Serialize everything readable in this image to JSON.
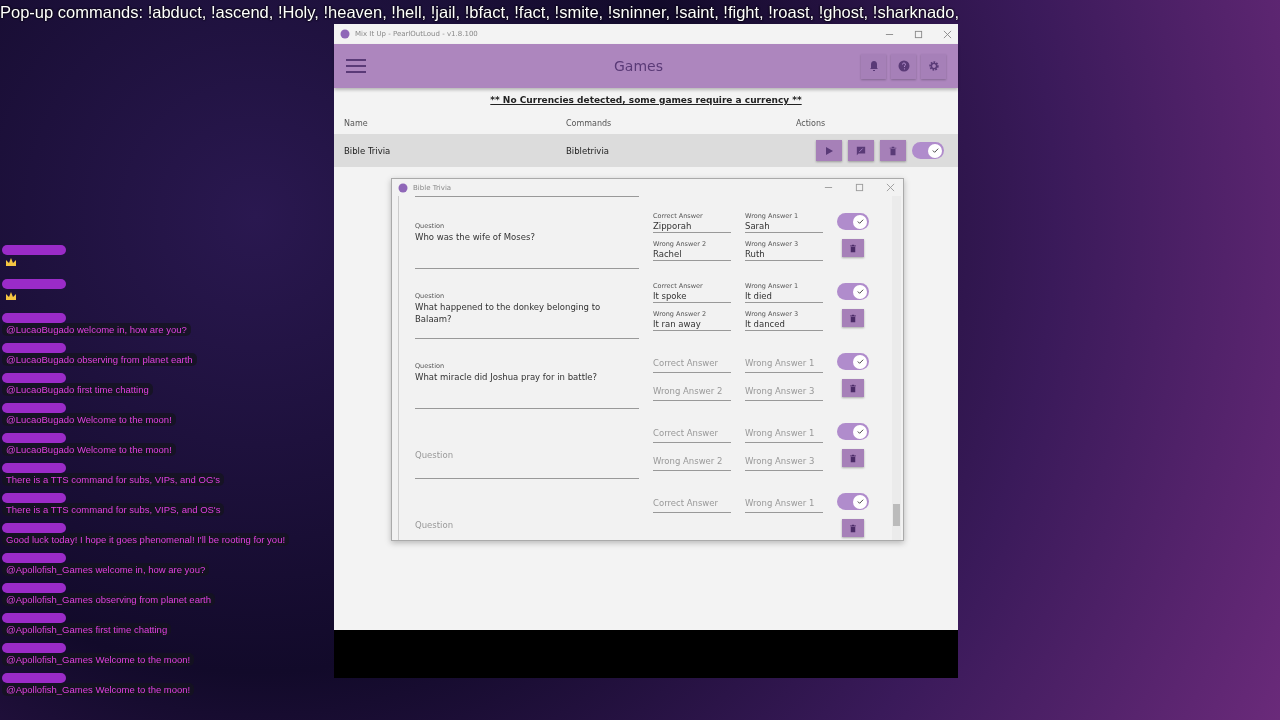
{
  "overlay_caption": "Pop-up commands: !abduct, !ascend, !Holy, !heaven, !hell,  !jail, !bfact, !fact, !smite, !sninner, !saint, !fight, !roast, !ghost, !sharknado,",
  "main_window": {
    "title": "Mix It Up - PearlOutLoud - v1.8.100",
    "heading": "Games",
    "notice": "** No Currencies detected, some games require a currency **",
    "columns": [
      "Name",
      "Commands",
      "Actions"
    ],
    "games": [
      {
        "name": "Bible Trivia",
        "command": "Bibletrivia",
        "enabled": true
      }
    ]
  },
  "dialog": {
    "title": "Bible Trivia",
    "questions": [
      {
        "question": {
          "label": "Question",
          "value": "Who was the wife of Moses?"
        },
        "enabled": true,
        "answers": [
          {
            "label": "Correct Answer",
            "value": "Zipporah"
          },
          {
            "label": "Wrong Answer 1",
            "value": "Sarah"
          },
          {
            "label": "Wrong Answer 2",
            "value": "Rachel"
          },
          {
            "label": "Wrong Answer 3",
            "value": "Ruth"
          }
        ]
      },
      {
        "question": {
          "label": "Question",
          "value": "What happened to the donkey belonging to Balaam?"
        },
        "enabled": true,
        "answers": [
          {
            "label": "Correct Answer",
            "value": "It spoke"
          },
          {
            "label": "Wrong Answer 1",
            "value": "It died"
          },
          {
            "label": "Wrong Answer 2",
            "value": "It ran away"
          },
          {
            "label": "Wrong Answer 3",
            "value": "It danced"
          }
        ]
      },
      {
        "question": {
          "label": "Question",
          "value": "What miracle did Joshua pray for in battle?"
        },
        "enabled": true,
        "answers": [
          {
            "placeholder": "Correct Answer"
          },
          {
            "placeholder": "Wrong Answer 1"
          },
          {
            "placeholder": "Wrong Answer 2"
          },
          {
            "placeholder": "Wrong Answer 3"
          }
        ]
      },
      {
        "question": {
          "placeholder": "Question"
        },
        "enabled": true,
        "answers": [
          {
            "placeholder": "Correct Answer"
          },
          {
            "placeholder": "Wrong Answer 1"
          },
          {
            "placeholder": "Wrong Answer 2"
          },
          {
            "placeholder": "Wrong Answer 3"
          }
        ]
      },
      {
        "question": {
          "placeholder": "Question"
        },
        "enabled": true,
        "answers": [
          {
            "placeholder": "Correct Answer"
          },
          {
            "placeholder": "Wrong Answer 1"
          }
        ]
      }
    ]
  },
  "chat": [
    {
      "kind": "emote"
    },
    {
      "kind": "emote"
    },
    {
      "kind": "text",
      "text": "@LucaoBugado welcome in, how are you?"
    },
    {
      "kind": "text",
      "text": "@LucaoBugado observing from planet earth"
    },
    {
      "kind": "text",
      "text": "@LucaoBugado first time chatting"
    },
    {
      "kind": "text",
      "text": "@LucaoBugado Welcome to the moon!"
    },
    {
      "kind": "text",
      "text": "@LucaoBugado Welcome to the moon!"
    },
    {
      "kind": "text",
      "text": "There is a TTS command for subs, VIPs, and OG's"
    },
    {
      "kind": "text",
      "text": "There is a TTS command for subs, VIPS, and OS's"
    },
    {
      "kind": "text",
      "text": "Good luck today! I hope it goes phenomenal! I'll be rooting for you!"
    },
    {
      "kind": "text",
      "text": "@Apollofish_Games welcome in, how are you?"
    },
    {
      "kind": "text",
      "text": "@Apollofish_Games observing from planet earth"
    },
    {
      "kind": "text",
      "text": "@Apollofish_Games first time chatting"
    },
    {
      "kind": "text",
      "text": "@Apollofish_Games Welcome to the moon!"
    },
    {
      "kind": "text",
      "text": "@Apollofish_Games Welcome to the moon!"
    }
  ]
}
